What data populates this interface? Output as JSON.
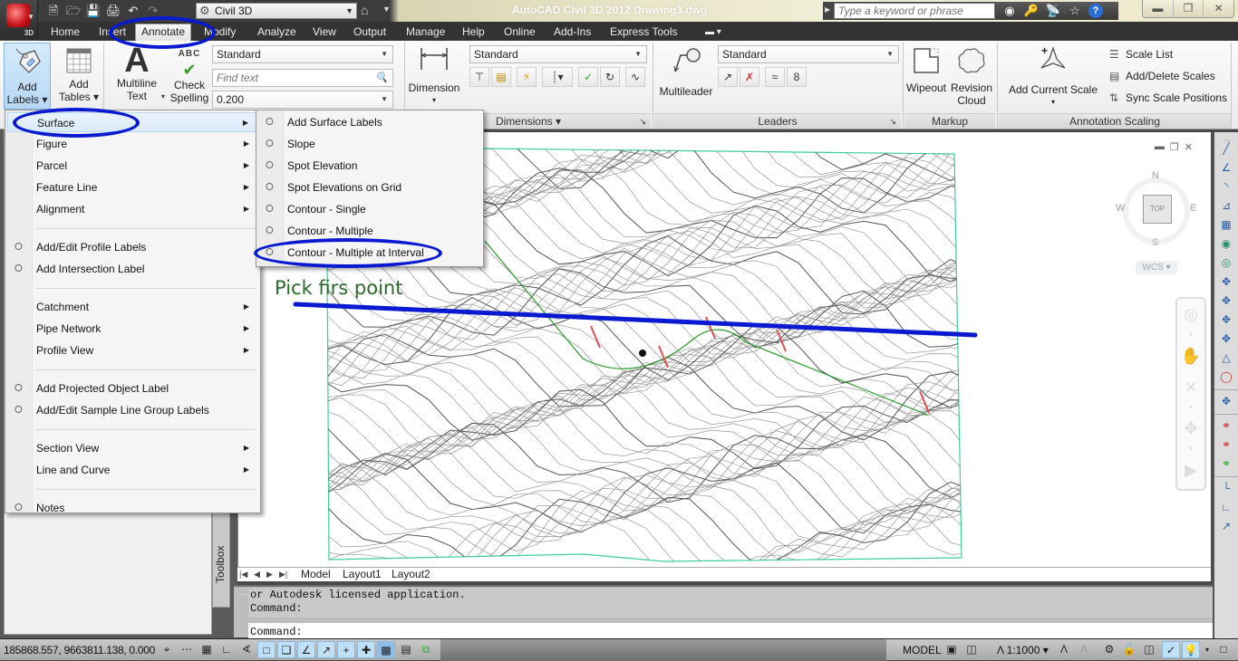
{
  "window": {
    "title": "AutoCAD Civil 3D 2012    Drawing3.dwg",
    "app_badge": "3D",
    "workspace": "Civil 3D",
    "search_placeholder": "Type a keyword or phrase",
    "controls": [
      "minimize",
      "restore",
      "close"
    ]
  },
  "quick_access": [
    "new-icon",
    "open-icon",
    "save-icon",
    "print-icon",
    "undo-icon",
    "redo-icon"
  ],
  "menu_tabs": [
    {
      "label": "Home",
      "active": false
    },
    {
      "label": "Insert",
      "active": false
    },
    {
      "label": "Annotate",
      "active": true
    },
    {
      "label": "Modify",
      "active": false
    },
    {
      "label": "Analyze",
      "active": false
    },
    {
      "label": "View",
      "active": false
    },
    {
      "label": "Output",
      "active": false
    },
    {
      "label": "Manage",
      "active": false
    },
    {
      "label": "Help",
      "active": false
    },
    {
      "label": "Online",
      "active": false
    },
    {
      "label": "Add-Ins",
      "active": false
    },
    {
      "label": "Express Tools",
      "active": false
    }
  ],
  "ribbon": {
    "add_labels": "Add\nLabels",
    "add_labels_l1": "Add",
    "add_labels_l2": "Labels",
    "add_tables_l1": "Add",
    "add_tables_l2": "Tables",
    "mtext_l1": "Multiline",
    "mtext_l2": "Text",
    "spell_l1": "Check",
    "spell_l2": "Spelling",
    "spell_glyph": "ABC",
    "text_style": "Standard",
    "find_placeholder": "Find text",
    "text_height": "0.200",
    "dimension": "Dimension",
    "dim_style": "Standard",
    "dimensions_panel": "Dimensions",
    "multileader": "Multileader",
    "leader_style": "Standard",
    "leaders_panel": "Leaders",
    "wipeout": "Wipeout",
    "revcloud_l1": "Revision",
    "revcloud_l2": "Cloud",
    "markup_panel": "Markup",
    "add_current_scale": "Add Current Scale",
    "scale_list": "Scale List",
    "add_delete_scales": "Add/Delete Scales",
    "sync_scale_positions": "Sync Scale Positions",
    "annotation_scaling_panel": "Annotation Scaling"
  },
  "add_labels_menu": [
    {
      "label": "Surface",
      "submenu": true,
      "highlighted": true
    },
    {
      "label": "Figure",
      "submenu": true
    },
    {
      "label": "Parcel",
      "submenu": true
    },
    {
      "label": "Feature Line",
      "submenu": true
    },
    {
      "label": "Alignment",
      "submenu": true
    },
    {
      "separator": true
    },
    {
      "label": "Add/Edit Profile Labels",
      "icon": "label-tag-icon"
    },
    {
      "label": "Add Intersection Label",
      "icon": "label-tag-icon"
    },
    {
      "separator": true
    },
    {
      "label": "Catchment",
      "submenu": true
    },
    {
      "label": "Pipe Network",
      "submenu": true
    },
    {
      "label": "Profile View",
      "submenu": true
    },
    {
      "separator": true
    },
    {
      "label": "Add Projected Object Label",
      "icon": "label-tag-icon"
    },
    {
      "label": "Add/Edit Sample Line Group Labels",
      "icon": "label-tag-icon"
    },
    {
      "separator": true
    },
    {
      "label": "Section View",
      "submenu": true
    },
    {
      "label": "Line and Curve",
      "submenu": true
    },
    {
      "separator": true
    },
    {
      "label": "Notes",
      "icon": "label-tag-icon"
    }
  ],
  "surface_submenu": [
    {
      "label": "Add Surface Labels"
    },
    {
      "label": "Slope"
    },
    {
      "label": "Spot Elevation"
    },
    {
      "label": "Spot Elevations on Grid"
    },
    {
      "label": "Contour - Single"
    },
    {
      "label": "Contour - Multiple"
    },
    {
      "label": "Contour - Multiple at Interval",
      "circled": true
    }
  ],
  "drawing": {
    "annotation_text": "Pick firs point",
    "viewcube": {
      "top": "TOP",
      "n": "N",
      "s": "S",
      "e": "E",
      "w": "W",
      "wcs": "WCS"
    }
  },
  "layout_tabs": [
    "Model",
    "Layout1",
    "Layout2"
  ],
  "toolbox_label": "Toolbox",
  "command_line": {
    "history": [
      "or Autodesk licensed application.",
      "Command:"
    ],
    "prompt": "Command:"
  },
  "status_bar": {
    "coordinates": "185868.557, 9663811.138, 0.000",
    "space": "MODEL",
    "annotation_scale": "1:1000"
  },
  "colors": {
    "annotation_blue": "#0a1ad0",
    "alignment_green": "#2a9a2a",
    "boundary_cyan": "#3ccf9a",
    "label_red": "#e05050"
  }
}
